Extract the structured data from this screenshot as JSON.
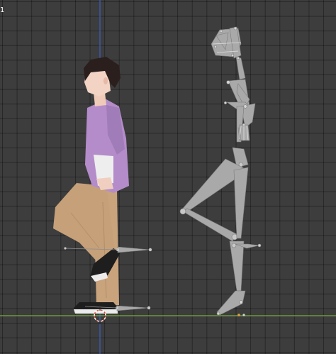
{
  "viewport": {
    "frame_label": "1",
    "colors": {
      "background": "#3d3d3d",
      "grid_line": "#2e2e2e",
      "z_axis": "#3a5fb8",
      "ground_axis": "#6d9a3a",
      "bone": "#a9a9a9",
      "bone_edge": "#7a7a7a",
      "shirt": "#b08ac8",
      "pants": "#c8a27a",
      "hair": "#2b1f1e",
      "skin": "#f1cfc0",
      "shoe": "#1e1e1e",
      "origin_marker": "#e04a3a"
    },
    "icons": [
      "3d-cursor-icon"
    ]
  }
}
